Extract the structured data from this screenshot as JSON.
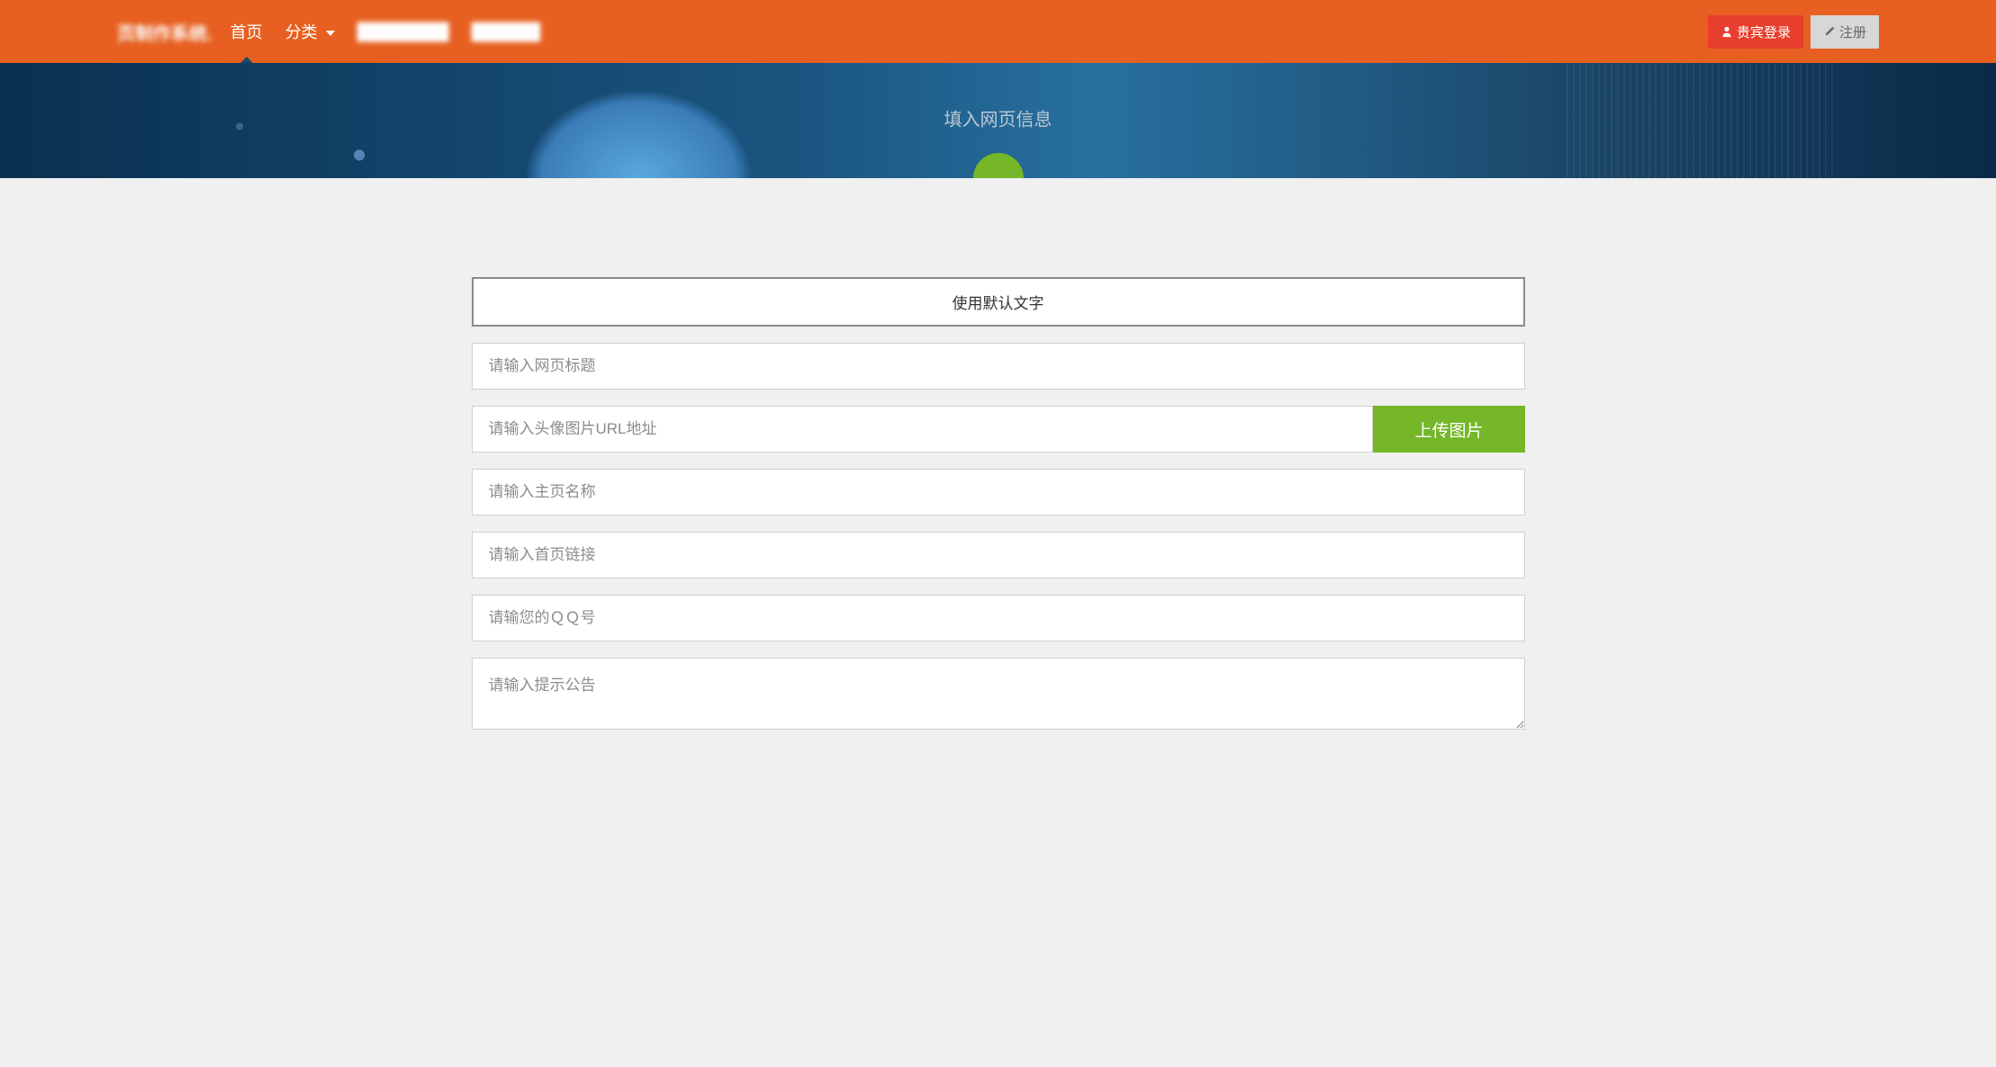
{
  "navbar": {
    "brand": "页制作系统.",
    "items": [
      {
        "label": "首页"
      },
      {
        "label": "分类"
      },
      {
        "label": "████████"
      },
      {
        "label": "██████"
      }
    ],
    "login_label": "贵宾登录",
    "register_label": "注册"
  },
  "hero": {
    "title": "填入网页信息"
  },
  "form": {
    "default_text_btn": "使用默认文字",
    "upload_btn": "上传图片",
    "title_placeholder": "请输入网页标题",
    "avatar_url_placeholder": "请输入头像图片URL地址",
    "home_name_placeholder": "请输入主页名称",
    "home_link_placeholder": "请输入首页链接",
    "qq_placeholder": "请输您的ＱＱ号",
    "notice_placeholder": "请输入提示公告"
  }
}
